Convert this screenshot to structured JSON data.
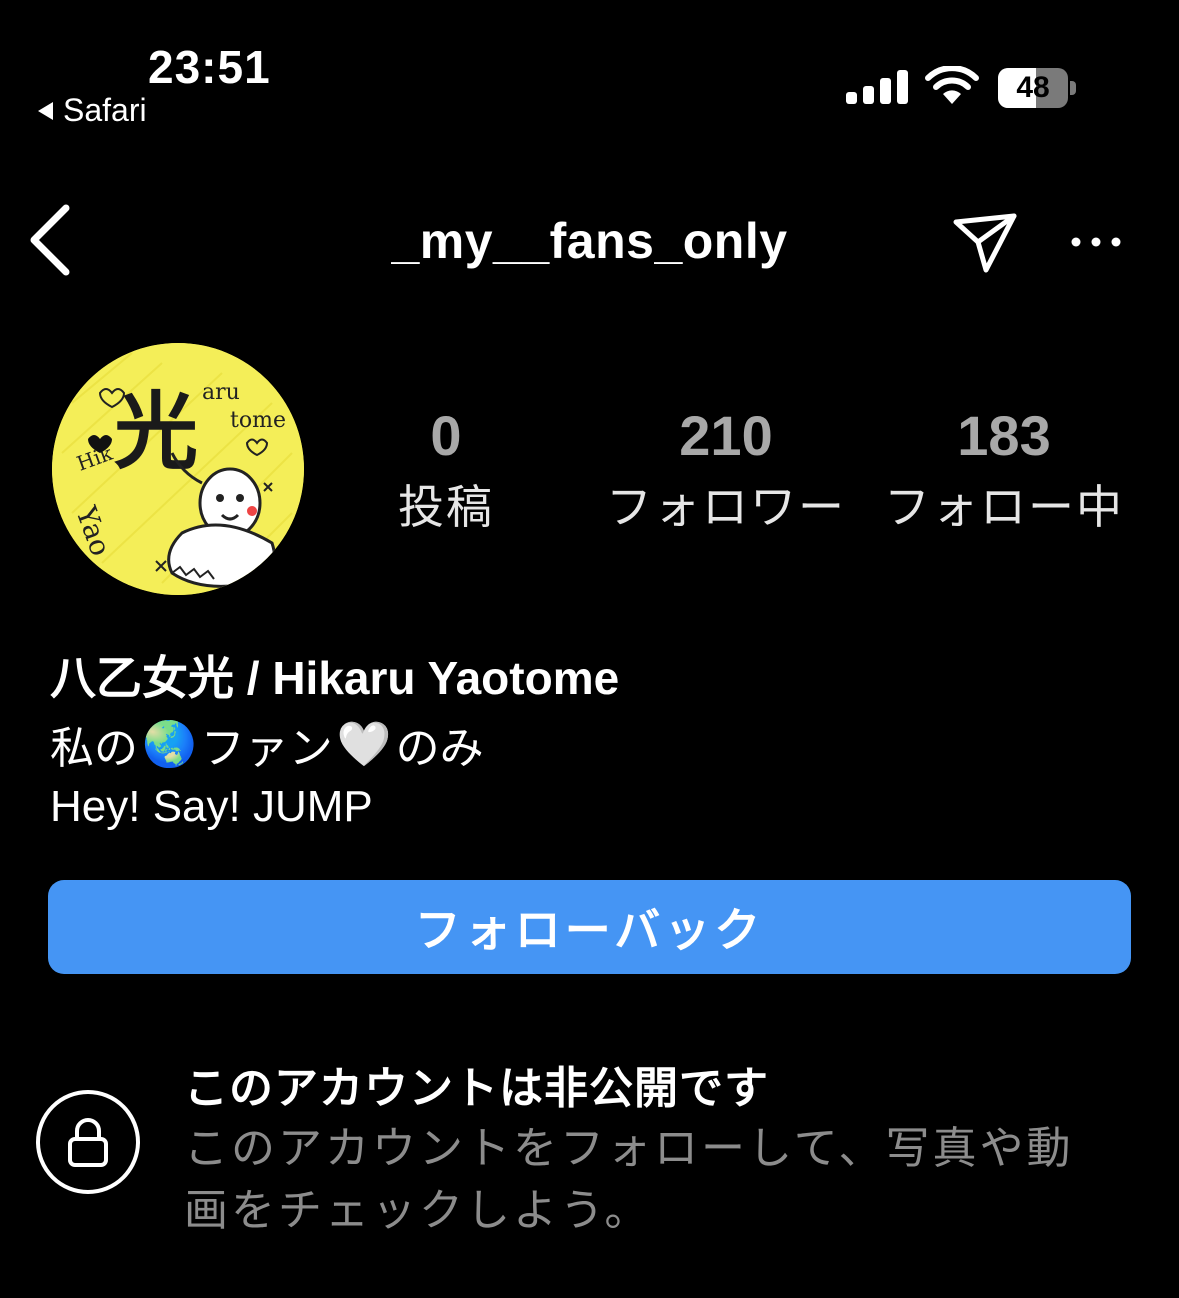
{
  "status_bar": {
    "time": "23:51",
    "back_app": "Safari",
    "battery": "48"
  },
  "header": {
    "username": "_my__fans_only",
    "icons": [
      "back-chevron-icon",
      "send-icon",
      "more-icon"
    ]
  },
  "profile": {
    "stats": [
      {
        "value": "0",
        "label": "投稿"
      },
      {
        "value": "210",
        "label": "フォロワー"
      },
      {
        "value": "183",
        "label": "フォロー中"
      }
    ],
    "full_name": "八乙女光 / Hikaru Yaotome",
    "bio_line1": {
      "a": "私の",
      "b": "ファン",
      "c": "のみ",
      "emoji1": "🌏",
      "emoji2": "🤍"
    },
    "bio_line2": "Hey! Say! JUMP",
    "avatar_text": {
      "kanji": "光",
      "top": "aru",
      "top2": "tome",
      "left": "Hik",
      "left2": "Yao"
    }
  },
  "follow_button": "フォローバック",
  "private": {
    "title": "このアカウントは非公開です",
    "description_line1": "このアカウントをフォローして、写真や動",
    "description_line2": "画をチェックしよう。"
  },
  "colors": {
    "accent": "#4595f4",
    "background": "#000000",
    "avatar_bg": "#f4ee58",
    "muted": "#8c8c8c"
  }
}
